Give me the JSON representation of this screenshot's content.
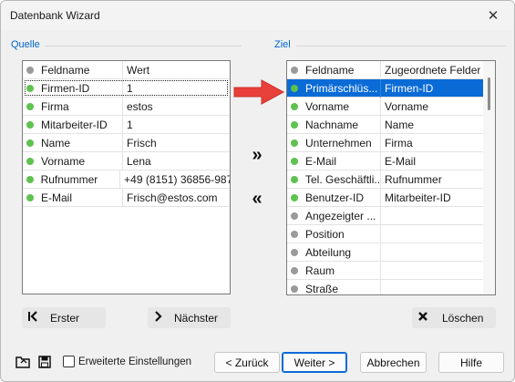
{
  "window": {
    "title": "Datenbank Wizard"
  },
  "source": {
    "label": "Quelle",
    "columns": [
      "Feldname",
      "Wert"
    ],
    "rows": [
      {
        "status": "green",
        "field": "Firmen-ID",
        "value": "1",
        "focused": true
      },
      {
        "status": "green",
        "field": "Firma",
        "value": "estos"
      },
      {
        "status": "green",
        "field": "Mitarbeiter-ID",
        "value": "1"
      },
      {
        "status": "green",
        "field": "Name",
        "value": "Frisch"
      },
      {
        "status": "green",
        "field": "Vorname",
        "value": "Lena"
      },
      {
        "status": "green",
        "field": "Rufnummer",
        "value": "+49 (8151) 36856-987"
      },
      {
        "status": "green",
        "field": "E-Mail",
        "value": "Frisch@estos.com"
      }
    ]
  },
  "target": {
    "label": "Ziel",
    "columns": [
      "Feldname",
      "Zugeordnete Felder"
    ],
    "rows": [
      {
        "status": "green",
        "field": "Primärschlüs...",
        "mapped": "Firmen-ID",
        "selected": true
      },
      {
        "status": "green",
        "field": "Vorname",
        "mapped": "Vorname"
      },
      {
        "status": "green",
        "field": "Nachname",
        "mapped": "Name"
      },
      {
        "status": "green",
        "field": "Unternehmen",
        "mapped": "Firma"
      },
      {
        "status": "green",
        "field": "E-Mail",
        "mapped": "E-Mail"
      },
      {
        "status": "green",
        "field": "Tel. Geschäftli...",
        "mapped": "Rufnummer"
      },
      {
        "status": "green",
        "field": "Benutzer-ID",
        "mapped": "Mitarbeiter-ID"
      },
      {
        "status": "gray",
        "field": "Angezeigter ...",
        "mapped": ""
      },
      {
        "status": "gray",
        "field": "Position",
        "mapped": ""
      },
      {
        "status": "gray",
        "field": "Abteilung",
        "mapped": ""
      },
      {
        "status": "gray",
        "field": "Raum",
        "mapped": ""
      },
      {
        "status": "gray",
        "field": "Straße",
        "mapped": ""
      }
    ]
  },
  "transfer": {
    "assign_icon": "double-chevron-right-icon",
    "unassign_icon": "double-chevron-left-icon"
  },
  "buttons": {
    "first": "Erster",
    "next": "Nächster",
    "delete": "Löschen",
    "back": "< Zurück",
    "forward": "Weiter >",
    "cancel": "Abbrechen",
    "help": "Hilfe"
  },
  "options": {
    "advanced_label": "Erweiterte Einstellungen",
    "advanced_checked": false
  },
  "colors": {
    "accent": "#0a6bd6",
    "group_label": "#0066cc",
    "status_green": "#5ec24f",
    "status_gray": "#9a9a9a",
    "pointer_arrow": "#e8413a"
  }
}
